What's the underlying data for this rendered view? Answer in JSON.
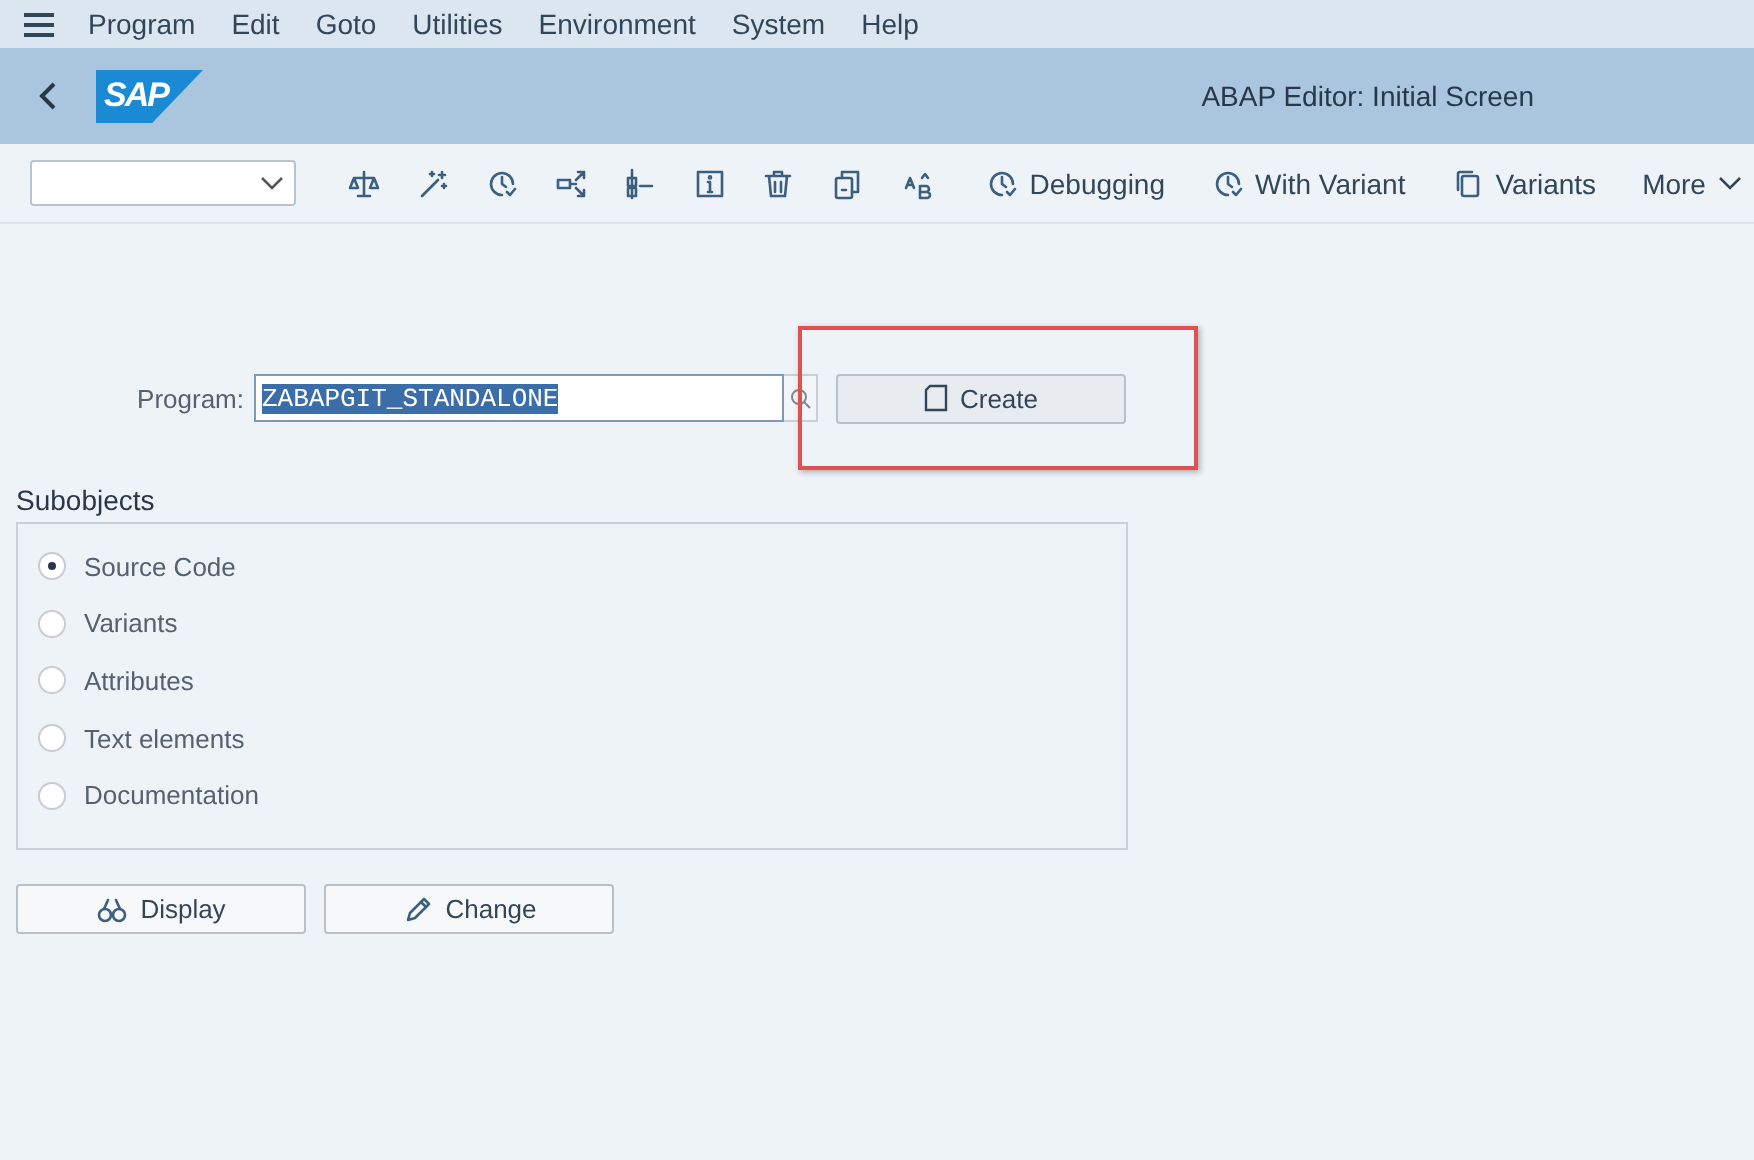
{
  "menu_bar": {
    "items": [
      "Program",
      "Edit",
      "Goto",
      "Utilities",
      "Environment",
      "System",
      "Help"
    ]
  },
  "header": {
    "logo_text": "SAP",
    "title": "ABAP Editor: Initial Screen"
  },
  "toolbar": {
    "text_buttons": [
      {
        "label": "Debugging",
        "kind": "debug"
      },
      {
        "label": "With Variant",
        "kind": "clock"
      },
      {
        "label": "Variants",
        "kind": "copy"
      }
    ],
    "more": "More"
  },
  "program_field": {
    "label": "Program:",
    "value": "ZABAPGIT_STANDALONE",
    "text_selected": true
  },
  "create_button": {
    "label": "Create",
    "highlighted": true
  },
  "subobjects": {
    "title": "Subobjects",
    "options": [
      {
        "label": "Source Code",
        "selected": true
      },
      {
        "label": "Variants",
        "selected": false
      },
      {
        "label": "Attributes",
        "selected": false
      },
      {
        "label": "Text elements",
        "selected": false
      },
      {
        "label": "Documentation",
        "selected": false
      }
    ]
  },
  "buttons": [
    {
      "label": "Display",
      "kind": "display"
    },
    {
      "label": "Change",
      "kind": "change"
    }
  ]
}
